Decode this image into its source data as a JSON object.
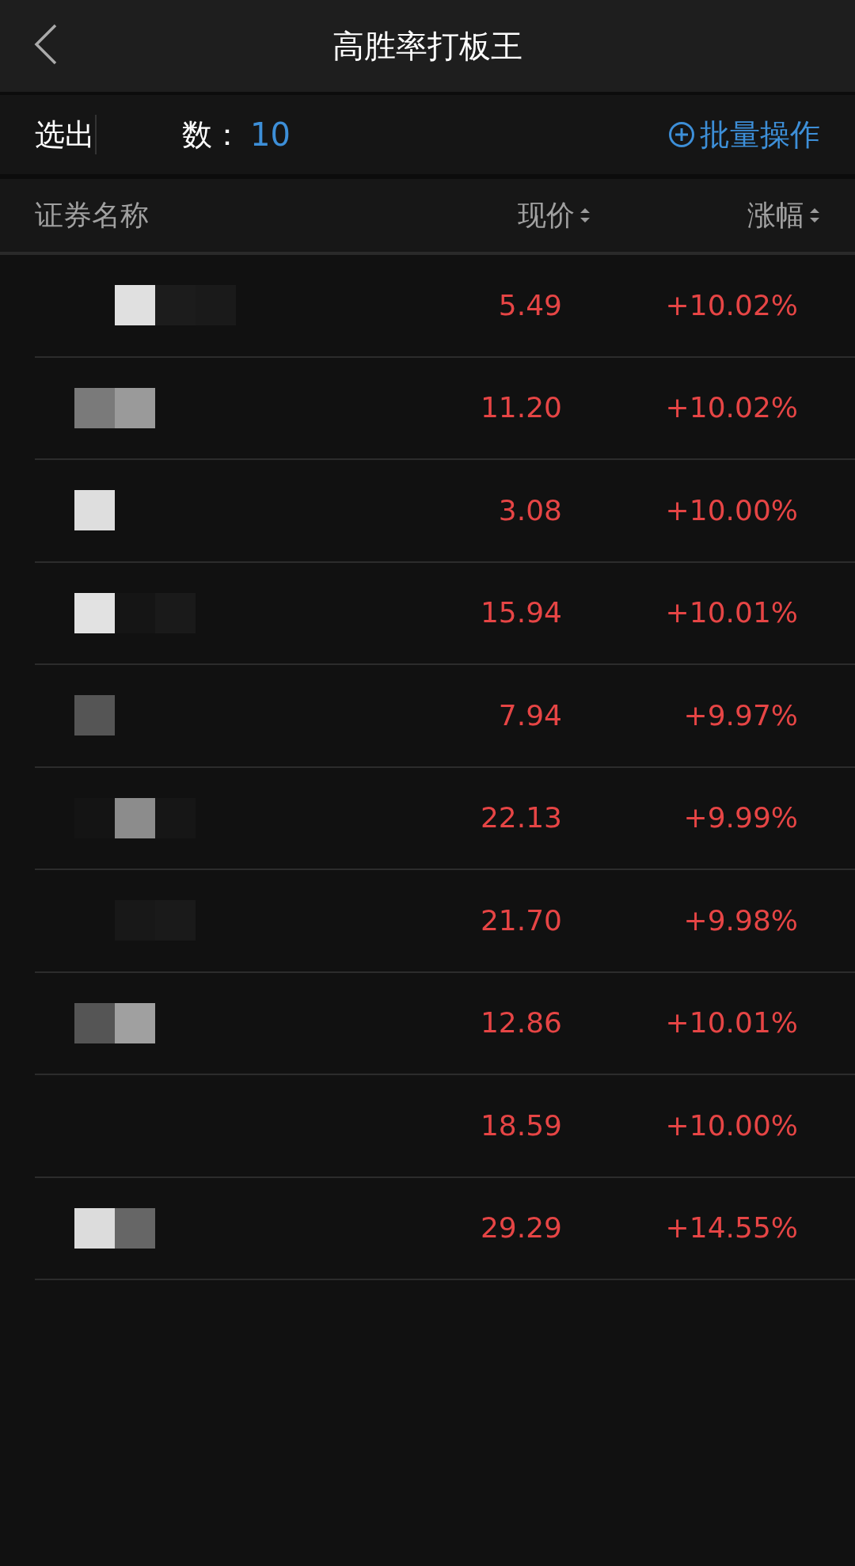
{
  "header": {
    "title": "高胜率打板王"
  },
  "summary": {
    "label_start": "选出",
    "label_end": "数：",
    "count": "10",
    "batch_action": "批量操作"
  },
  "columns": [
    {
      "label": "证券名称",
      "sortable": false
    },
    {
      "label": "现价",
      "sortable": true
    },
    {
      "label": "涨幅",
      "sortable": true
    }
  ],
  "rows": [
    {
      "price": "5.49",
      "change": "+10.02%"
    },
    {
      "price": "11.20",
      "change": "+10.02%"
    },
    {
      "price": "3.08",
      "change": "+10.00%"
    },
    {
      "price": "15.94",
      "change": "+10.01%"
    },
    {
      "price": "7.94",
      "change": "+9.97%"
    },
    {
      "price": "22.13",
      "change": "+9.99%"
    },
    {
      "price": "21.70",
      "change": "+9.98%"
    },
    {
      "price": "12.86",
      "change": "+10.01%"
    },
    {
      "price": "18.59",
      "change": "+10.00%"
    },
    {
      "price": "29.29",
      "change": "+14.55%"
    }
  ]
}
